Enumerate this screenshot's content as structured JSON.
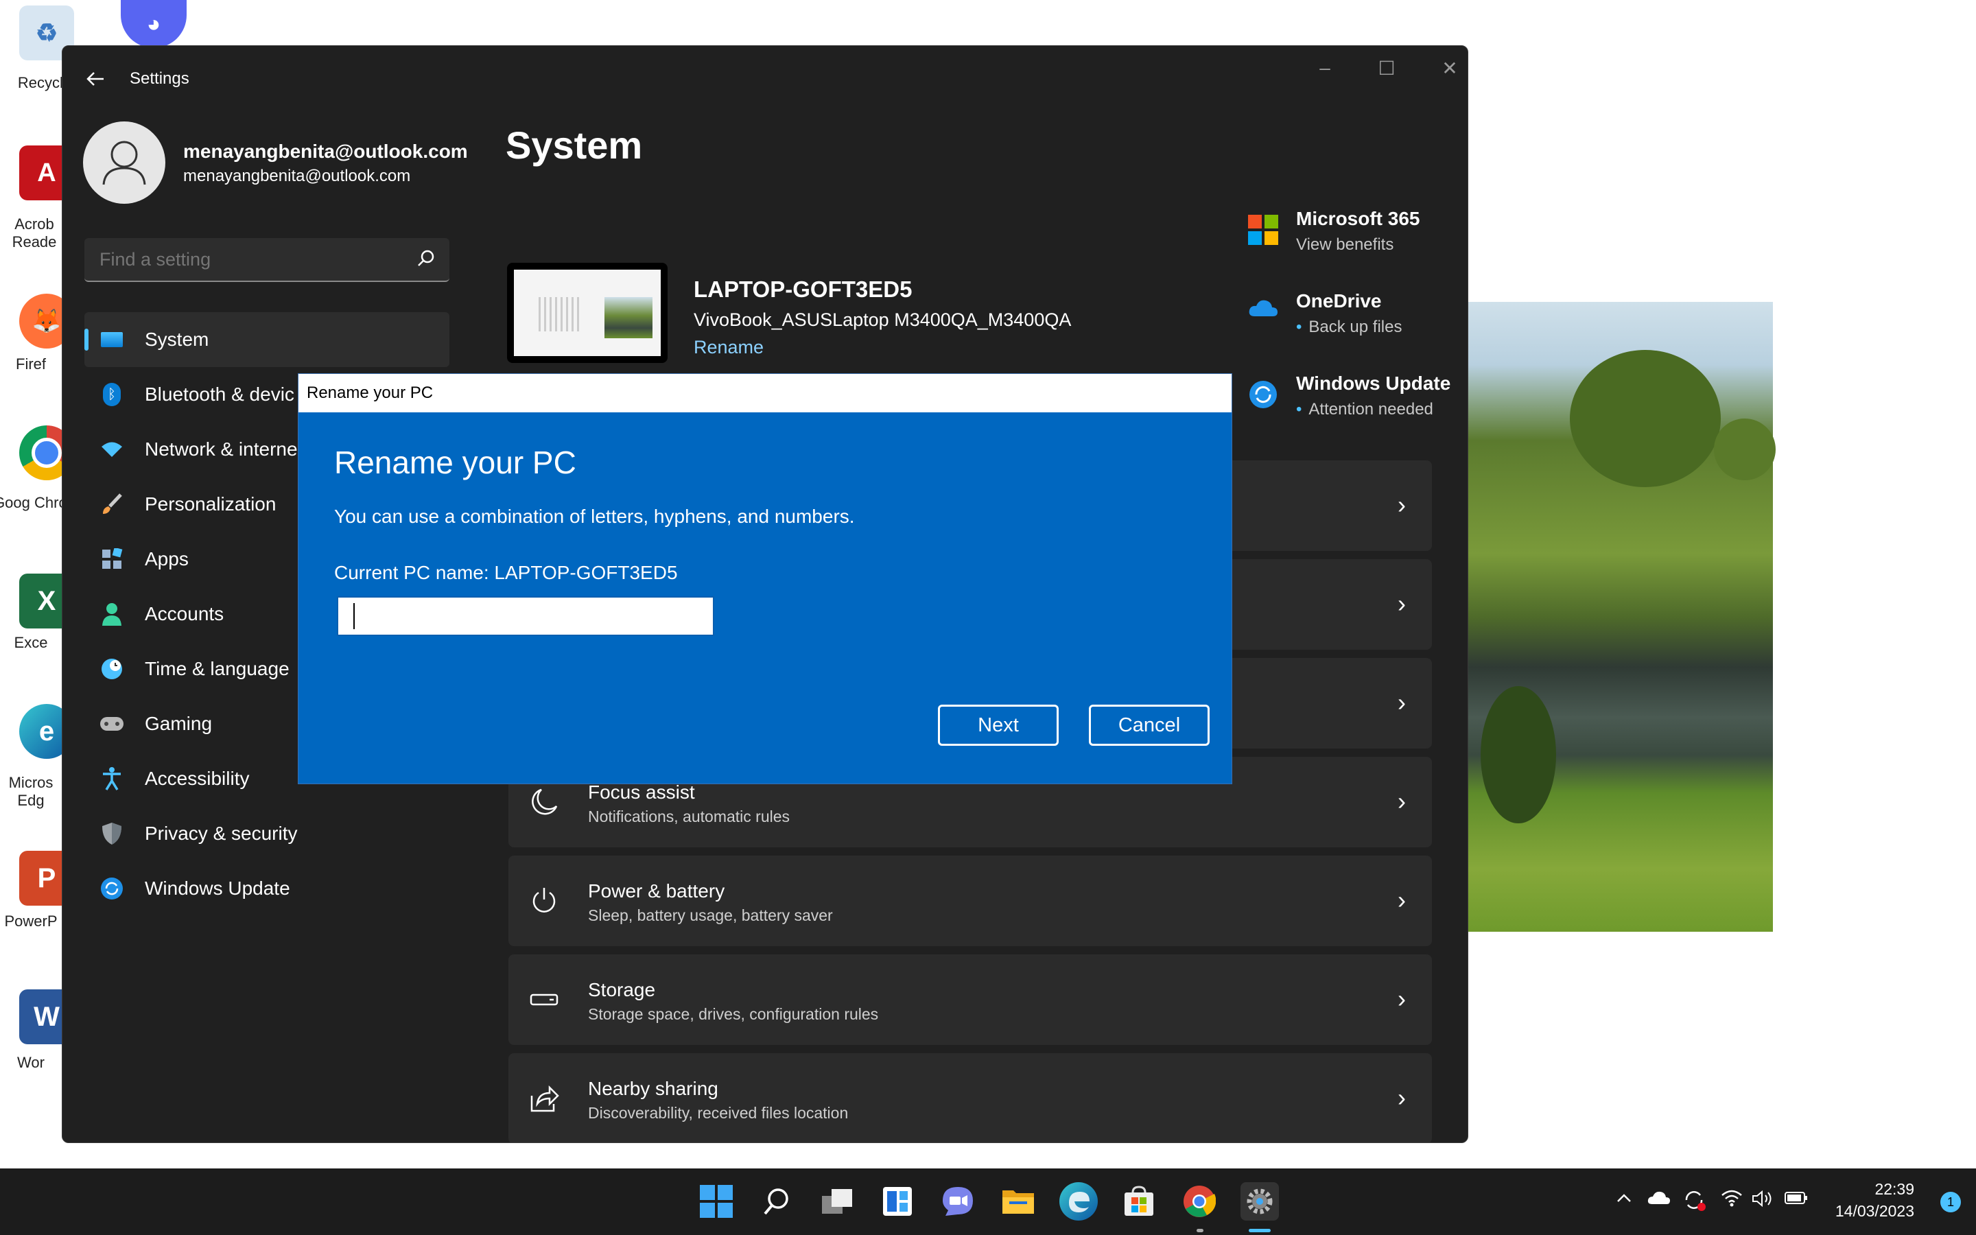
{
  "desktop": {
    "icons": [
      {
        "label": "Recycle",
        "name": "recycle-bin"
      },
      {
        "label": "Acrob Reade",
        "name": "acrobat-reader"
      },
      {
        "label": "Firef",
        "name": "firefox"
      },
      {
        "label": "Goog Chron",
        "name": "google-chrome"
      },
      {
        "label": "Exce",
        "name": "excel"
      },
      {
        "label": "Micros Edg",
        "name": "microsoft-edge"
      },
      {
        "label": "PowerP",
        "name": "powerpoint"
      },
      {
        "label": "Wor",
        "name": "word"
      }
    ]
  },
  "window": {
    "title": "Settings",
    "account": {
      "name": "menayangbenita@outlook.com",
      "email": "menayangbenita@outlook.com"
    },
    "search_placeholder": "Find a setting",
    "nav": [
      {
        "label": "System",
        "icon": "monitor-icon",
        "active": true
      },
      {
        "label": "Bluetooth & devic",
        "icon": "bluetooth-icon"
      },
      {
        "label": "Network & interne",
        "icon": "wifi-icon"
      },
      {
        "label": "Personalization",
        "icon": "brush-icon"
      },
      {
        "label": "Apps",
        "icon": "apps-icon"
      },
      {
        "label": "Accounts",
        "icon": "person-icon"
      },
      {
        "label": "Time & language",
        "icon": "clock-globe-icon"
      },
      {
        "label": "Gaming",
        "icon": "gamepad-icon"
      },
      {
        "label": "Accessibility",
        "icon": "accessibility-icon"
      },
      {
        "label": "Privacy & security",
        "icon": "shield-icon"
      },
      {
        "label": "Windows Update",
        "icon": "update-icon"
      }
    ],
    "page_title": "System",
    "pc": {
      "name": "LAPTOP-GOFT3ED5",
      "model": "VivoBook_ASUSLaptop M3400QA_M3400QA",
      "rename_label": "Rename"
    },
    "quick_links": [
      {
        "title": "Microsoft 365",
        "subtitle": "View benefits",
        "icon": "microsoft-logo-icon"
      },
      {
        "title": "OneDrive",
        "subtitle": "Back up files",
        "icon": "onedrive-cloud-icon"
      },
      {
        "title": "Windows Update",
        "subtitle": "Attention needed",
        "icon": "windows-update-icon"
      }
    ],
    "rows": [
      {
        "title": "Focus assist",
        "subtitle": "Notifications, automatic rules",
        "icon": "moon-icon"
      },
      {
        "title": "Power & battery",
        "subtitle": "Sleep, battery usage, battery saver",
        "icon": "power-icon"
      },
      {
        "title": "Storage",
        "subtitle": "Storage space, drives, configuration rules",
        "icon": "drive-icon"
      },
      {
        "title": "Nearby sharing",
        "subtitle": "Discoverability, received files location",
        "icon": "share-icon"
      }
    ]
  },
  "dialog": {
    "window_title": "Rename your PC",
    "heading": "Rename your PC",
    "description": "You can use a combination of letters, hyphens, and numbers.",
    "current_name": "Current PC name: LAPTOP-GOFT3ED5",
    "input_value": "",
    "next_label": "Next",
    "cancel_label": "Cancel"
  },
  "taskbar": {
    "time": "22:39",
    "date": "14/03/2023",
    "notification_count": "1"
  },
  "colors": {
    "dialog_blue": "#0067c0",
    "accent": "#4cc2ff",
    "window_bg": "#202020"
  }
}
